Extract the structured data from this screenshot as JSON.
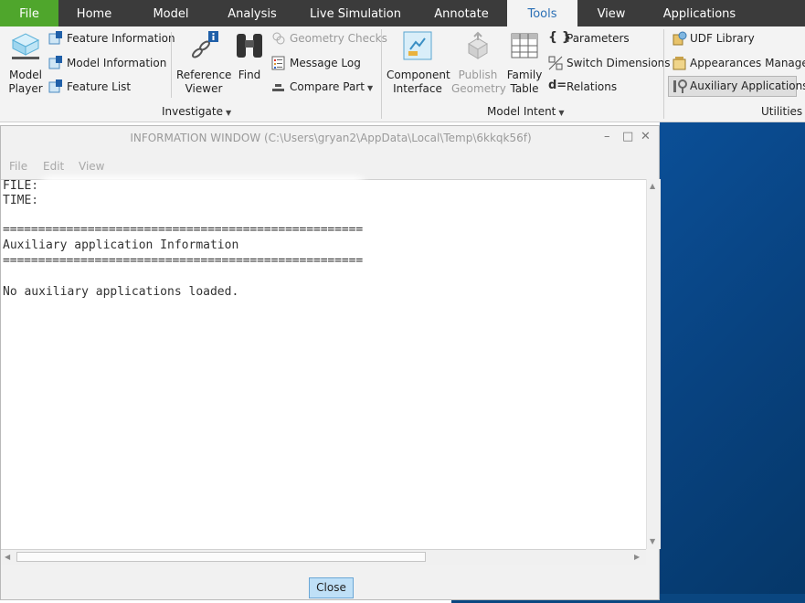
{
  "tabs": [
    "File",
    "Home",
    "Model",
    "Analysis",
    "Live Simulation",
    "Annotate",
    "Tools",
    "View",
    "Applications"
  ],
  "active_tab": "Tools",
  "ribbon": {
    "model_player": [
      "Model",
      "Player"
    ],
    "feature_information": "Feature Information",
    "model_information": "Model Information",
    "feature_list": "Feature List",
    "reference_viewer": [
      "Reference",
      "Viewer"
    ],
    "find": "Find",
    "geometry_checks": "Geometry Checks",
    "message_log": "Message Log",
    "compare_part": "Compare Part",
    "investigate_group": "Investigate",
    "component_interface": [
      "Component",
      "Interface"
    ],
    "publish_geometry": [
      "Publish",
      "Geometry"
    ],
    "family_table": [
      "Family",
      "Table"
    ],
    "parameters": "Parameters",
    "switch_dimensions": "Switch Dimensions",
    "relations": "Relations",
    "model_intent_group": "Model Intent",
    "udf_library": "UDF Library",
    "appearances_manager": "Appearances Manager",
    "auxiliary_applications": "Auxiliary Applications",
    "utilities_group": "Utilities"
  },
  "dialog": {
    "title": "INFORMATION  WINDOW (C:\\Users\\gryan2\\AppData\\Local\\Temp\\6kkqk56f)",
    "menu": [
      "File",
      "Edit",
      "View"
    ],
    "lines": [
      "FILE:",
      "TIME:",
      "",
      "===================================================",
      "Auxiliary application Information",
      "===================================================",
      "",
      "No auxiliary applications loaded."
    ],
    "close_label": "Close"
  },
  "colors": {
    "tabbar": "#3b3b3b",
    "file_tab": "#4fa62c",
    "active_tab_text": "#2a6fb5",
    "graphics_area": "#08427f",
    "close_button": "#bfe0f7"
  }
}
